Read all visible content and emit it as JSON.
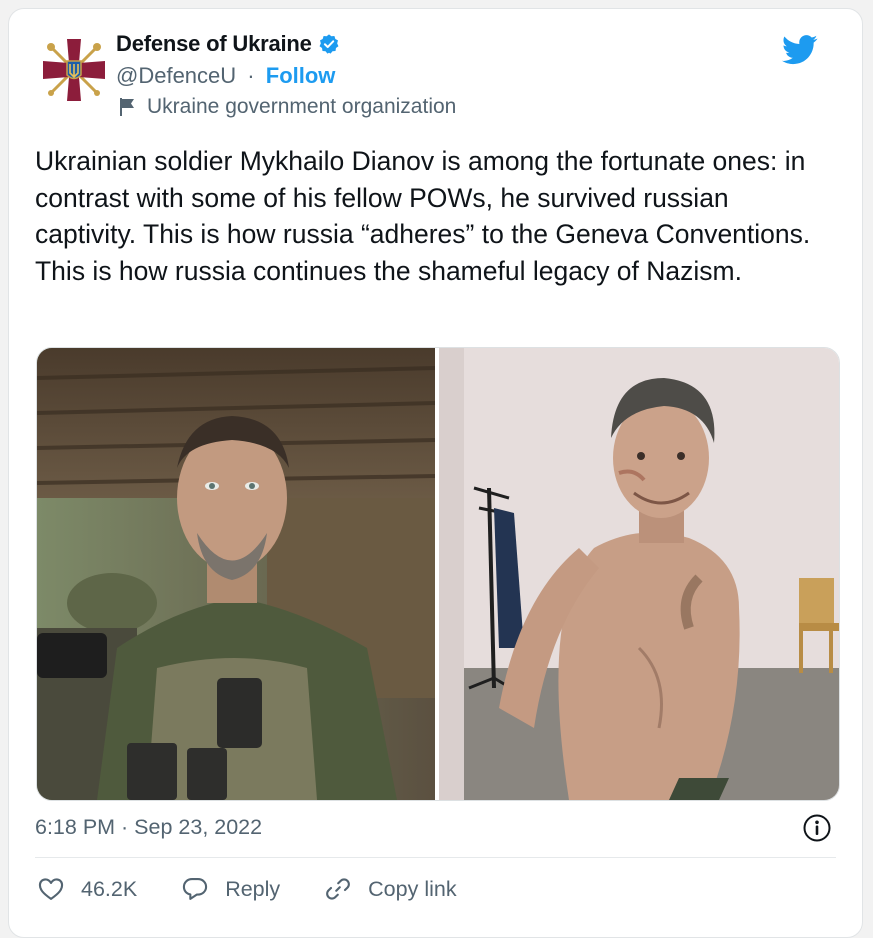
{
  "author": {
    "display_name": "Defense of Ukraine",
    "handle": "@DefenceU",
    "separator": "·",
    "follow_label": "Follow",
    "label": "Ukraine government organization"
  },
  "tweet": {
    "text": "Ukrainian soldier Mykhailo Dianov is among the fortunate ones: in contrast with some of his fellow POWs, he survived russian captivity. This is how russia “adheres” to the Geneva Conventions. This is how russia continues the shameful legacy of Nazism.",
    "timestamp": "6:18 PM · Sep 23, 2022"
  },
  "actions": {
    "like_count": "46.2K",
    "reply_label": "Reply",
    "copy_label": "Copy link"
  },
  "icons": {
    "brand": "twitter-bird-icon",
    "verified": "verified-badge-icon",
    "label": "flag-icon",
    "info": "info-icon",
    "like": "heart-icon",
    "reply": "speech-bubble-icon",
    "copy": "link-icon"
  },
  "colors": {
    "accent": "#1d9bf0",
    "secondary_text": "#536471",
    "avatar_maroon": "#8c1d3b",
    "avatar_gold": "#c9a24a"
  }
}
